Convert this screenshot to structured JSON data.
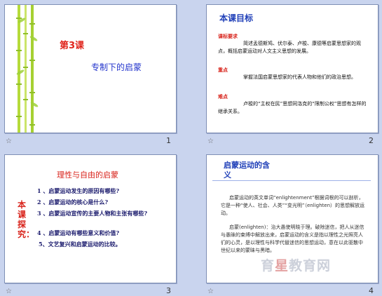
{
  "slides": [
    {
      "number": "1",
      "title1": "第3课",
      "title2": "专制下的启蒙"
    },
    {
      "number": "2",
      "heading": "本课目标",
      "label1": "课标要求",
      "para1": "简述孟德斯鸠、伏尔泰、卢梭、康德等启蒙思想家的观点，概括启蒙运动对人文主义思想的发展。",
      "label2": "重点",
      "para2": "掌握法国启蒙思想家的代表人物和他们的政治思想。",
      "label3": "难点",
      "para3": "卢梭的“主权在民”思想同洛克的“限制公权”思想有怎样的继承关系。"
    },
    {
      "number": "3",
      "heading": "理性与自由的启蒙",
      "side_label": "本课探究：",
      "questions": [
        "1 、启蒙运动发生的原因有哪些?",
        "2 、启蒙运动的核心是什么?",
        "3 、启蒙运动宣传的主要人物和主张有哪些?",
        "4 、启蒙运动有哪些意义和价值?",
        "5、文艺复兴和启蒙运动的比较。"
      ]
    },
    {
      "number": "4",
      "heading": "启蒙运动的含义",
      "para1": "启蒙运动的英文单词“enlightenment”根据词根的可以剖析，它是一种“使人、社会、人类”“变光明”（enlighten）的思想解放运动。",
      "para2": "启蒙(enlighten)：治大愚使明晓于理。破除迷信，把人从迷信与愚昧的束缚中解放出来，启蒙运动的含义是指以理性之光照亮人们的心灵，是以理性与科学代替迷信的思想运动，意在以此驱散中世纪以来的蒙昧与黑暗。"
    }
  ],
  "watermark": {
    "part1": "育",
    "part2": "星",
    "part3": "教育网"
  },
  "colors": {
    "background": "#c9d4ee",
    "red": "#d8231b",
    "blue": "#1f3fb8"
  }
}
